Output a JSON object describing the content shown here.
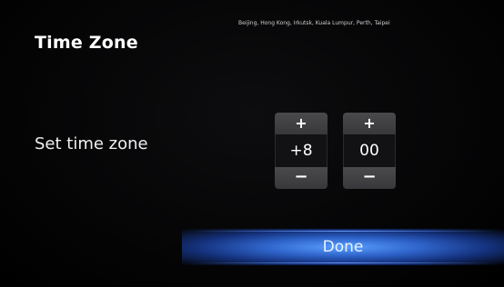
{
  "header": {
    "title": "Time Zone",
    "zone_cities": "Beijing, Hong Kong, Irkutsk, Kuala Lumpur, Perth, Taipei"
  },
  "timezone": {
    "label": "Set time zone",
    "hours": {
      "value": "+8",
      "increment": "+",
      "decrement": "−"
    },
    "minutes": {
      "value": "00",
      "increment": "+",
      "decrement": "−"
    }
  },
  "actions": {
    "done_label": "Done"
  },
  "colors": {
    "accent": "#2e63c9",
    "button_gray": "#45454a",
    "background": "#000000"
  }
}
